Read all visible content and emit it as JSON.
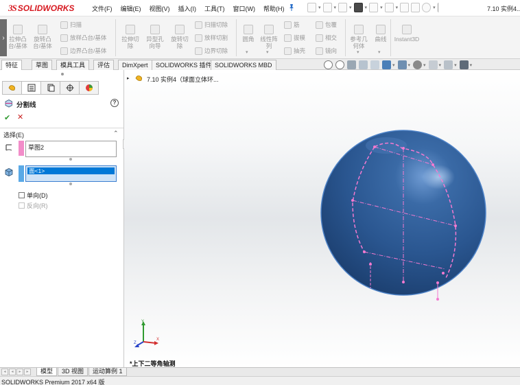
{
  "app": {
    "brand_ds": "3S",
    "brand_name": "SOLIDWORKS",
    "document_title": "7.10 实例4..."
  },
  "menu": [
    "文件(F)",
    "编辑(E)",
    "视图(V)",
    "插入(I)",
    "工具(T)",
    "窗口(W)",
    "帮助(H)"
  ],
  "command_manager": {
    "extrude_boss": "拉伸凸\n台/基体",
    "revolve_boss": "旋转凸\n台/基体",
    "sweep": "扫描",
    "loft_boss": "放样凸台/基体",
    "boundary_boss": "边界凸台/基体",
    "extrude_cut": "拉伸切\n除",
    "hole_wizard": "异型孔\n向导",
    "revolve_cut": "旋转切\n除",
    "sweep_cut": "扫描切除",
    "loft_cut": "放样切割",
    "boundary_cut": "边界切除",
    "fillet": "圆角",
    "linear_pattern": "线性阵\n列",
    "rib": "筋",
    "draft": "拔模",
    "shell": "抽壳",
    "wrap": "包覆",
    "intersect": "相交",
    "mirror": "镜向",
    "reference_geometry": "参考几\n何体",
    "curves": "曲线",
    "instant3d": "Instant3D"
  },
  "tabs": [
    "特征",
    "草图",
    "模具工具",
    "评估",
    "DimXpert",
    "SOLIDWORKS 插件",
    "SOLIDWORKS MBD"
  ],
  "property_manager": {
    "title": "分割线",
    "help": "?",
    "ok": "✔",
    "cancel": "✕",
    "selection_label": "选择(E)",
    "collapse": "⌃",
    "sketch_item": "草图2",
    "face_item": "面<1>",
    "single_direction": "单向(D)",
    "reverse_direction": "反向(R)"
  },
  "graphics": {
    "tree_arrow": "▸",
    "tree_label": "7.10 实例4（球面立体环...",
    "view_name": "*上下二等角轴测",
    "sphere_color": "#2e5c95",
    "sketch_color": "#f47ad0"
  },
  "bottom_tabs": [
    "模型",
    "3D 视图",
    "运动算例 1"
  ],
  "status_bar": "SOLIDWORKS Premium 2017 x64 版"
}
